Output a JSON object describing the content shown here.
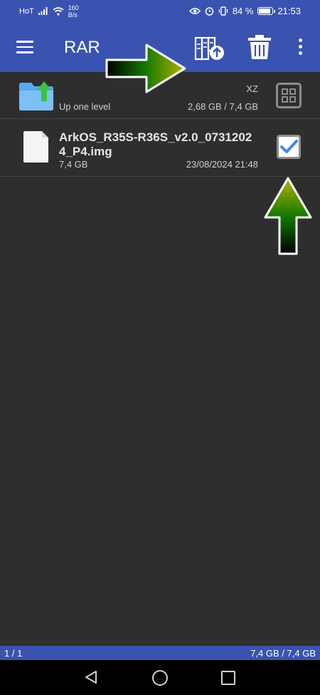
{
  "status_bar": {
    "carrier": "HoT",
    "net_speed_value": "160",
    "net_speed_unit": "B/s",
    "battery_percent": "84 %",
    "time": "21:53"
  },
  "toolbar": {
    "title": "RAR",
    "menu_icon": "hamburger-menu-icon",
    "extract_icon": "extract-archive-icon",
    "delete_icon": "trash-icon",
    "more_icon": "more-vertical-icon"
  },
  "files": {
    "up_row": {
      "label": "Up one level",
      "type": "XZ",
      "space": "2,68 GB / 7,4 GB"
    },
    "file_row": {
      "name": "ArkOS_R35S-R36S_v2.0_07312024_P4.img",
      "size": "7,4 GB",
      "modified": "23/08/2024 21:48",
      "checked": true
    }
  },
  "info_bar": {
    "selection": "1 / 1",
    "selected_size": "7,4 GB / 7,4 GB"
  },
  "colors": {
    "toolbar_bg": "#3a53b0",
    "content_bg": "#2e2e2e",
    "check_blue": "#3c8de6",
    "annotation_arrow": "#b5b000"
  }
}
